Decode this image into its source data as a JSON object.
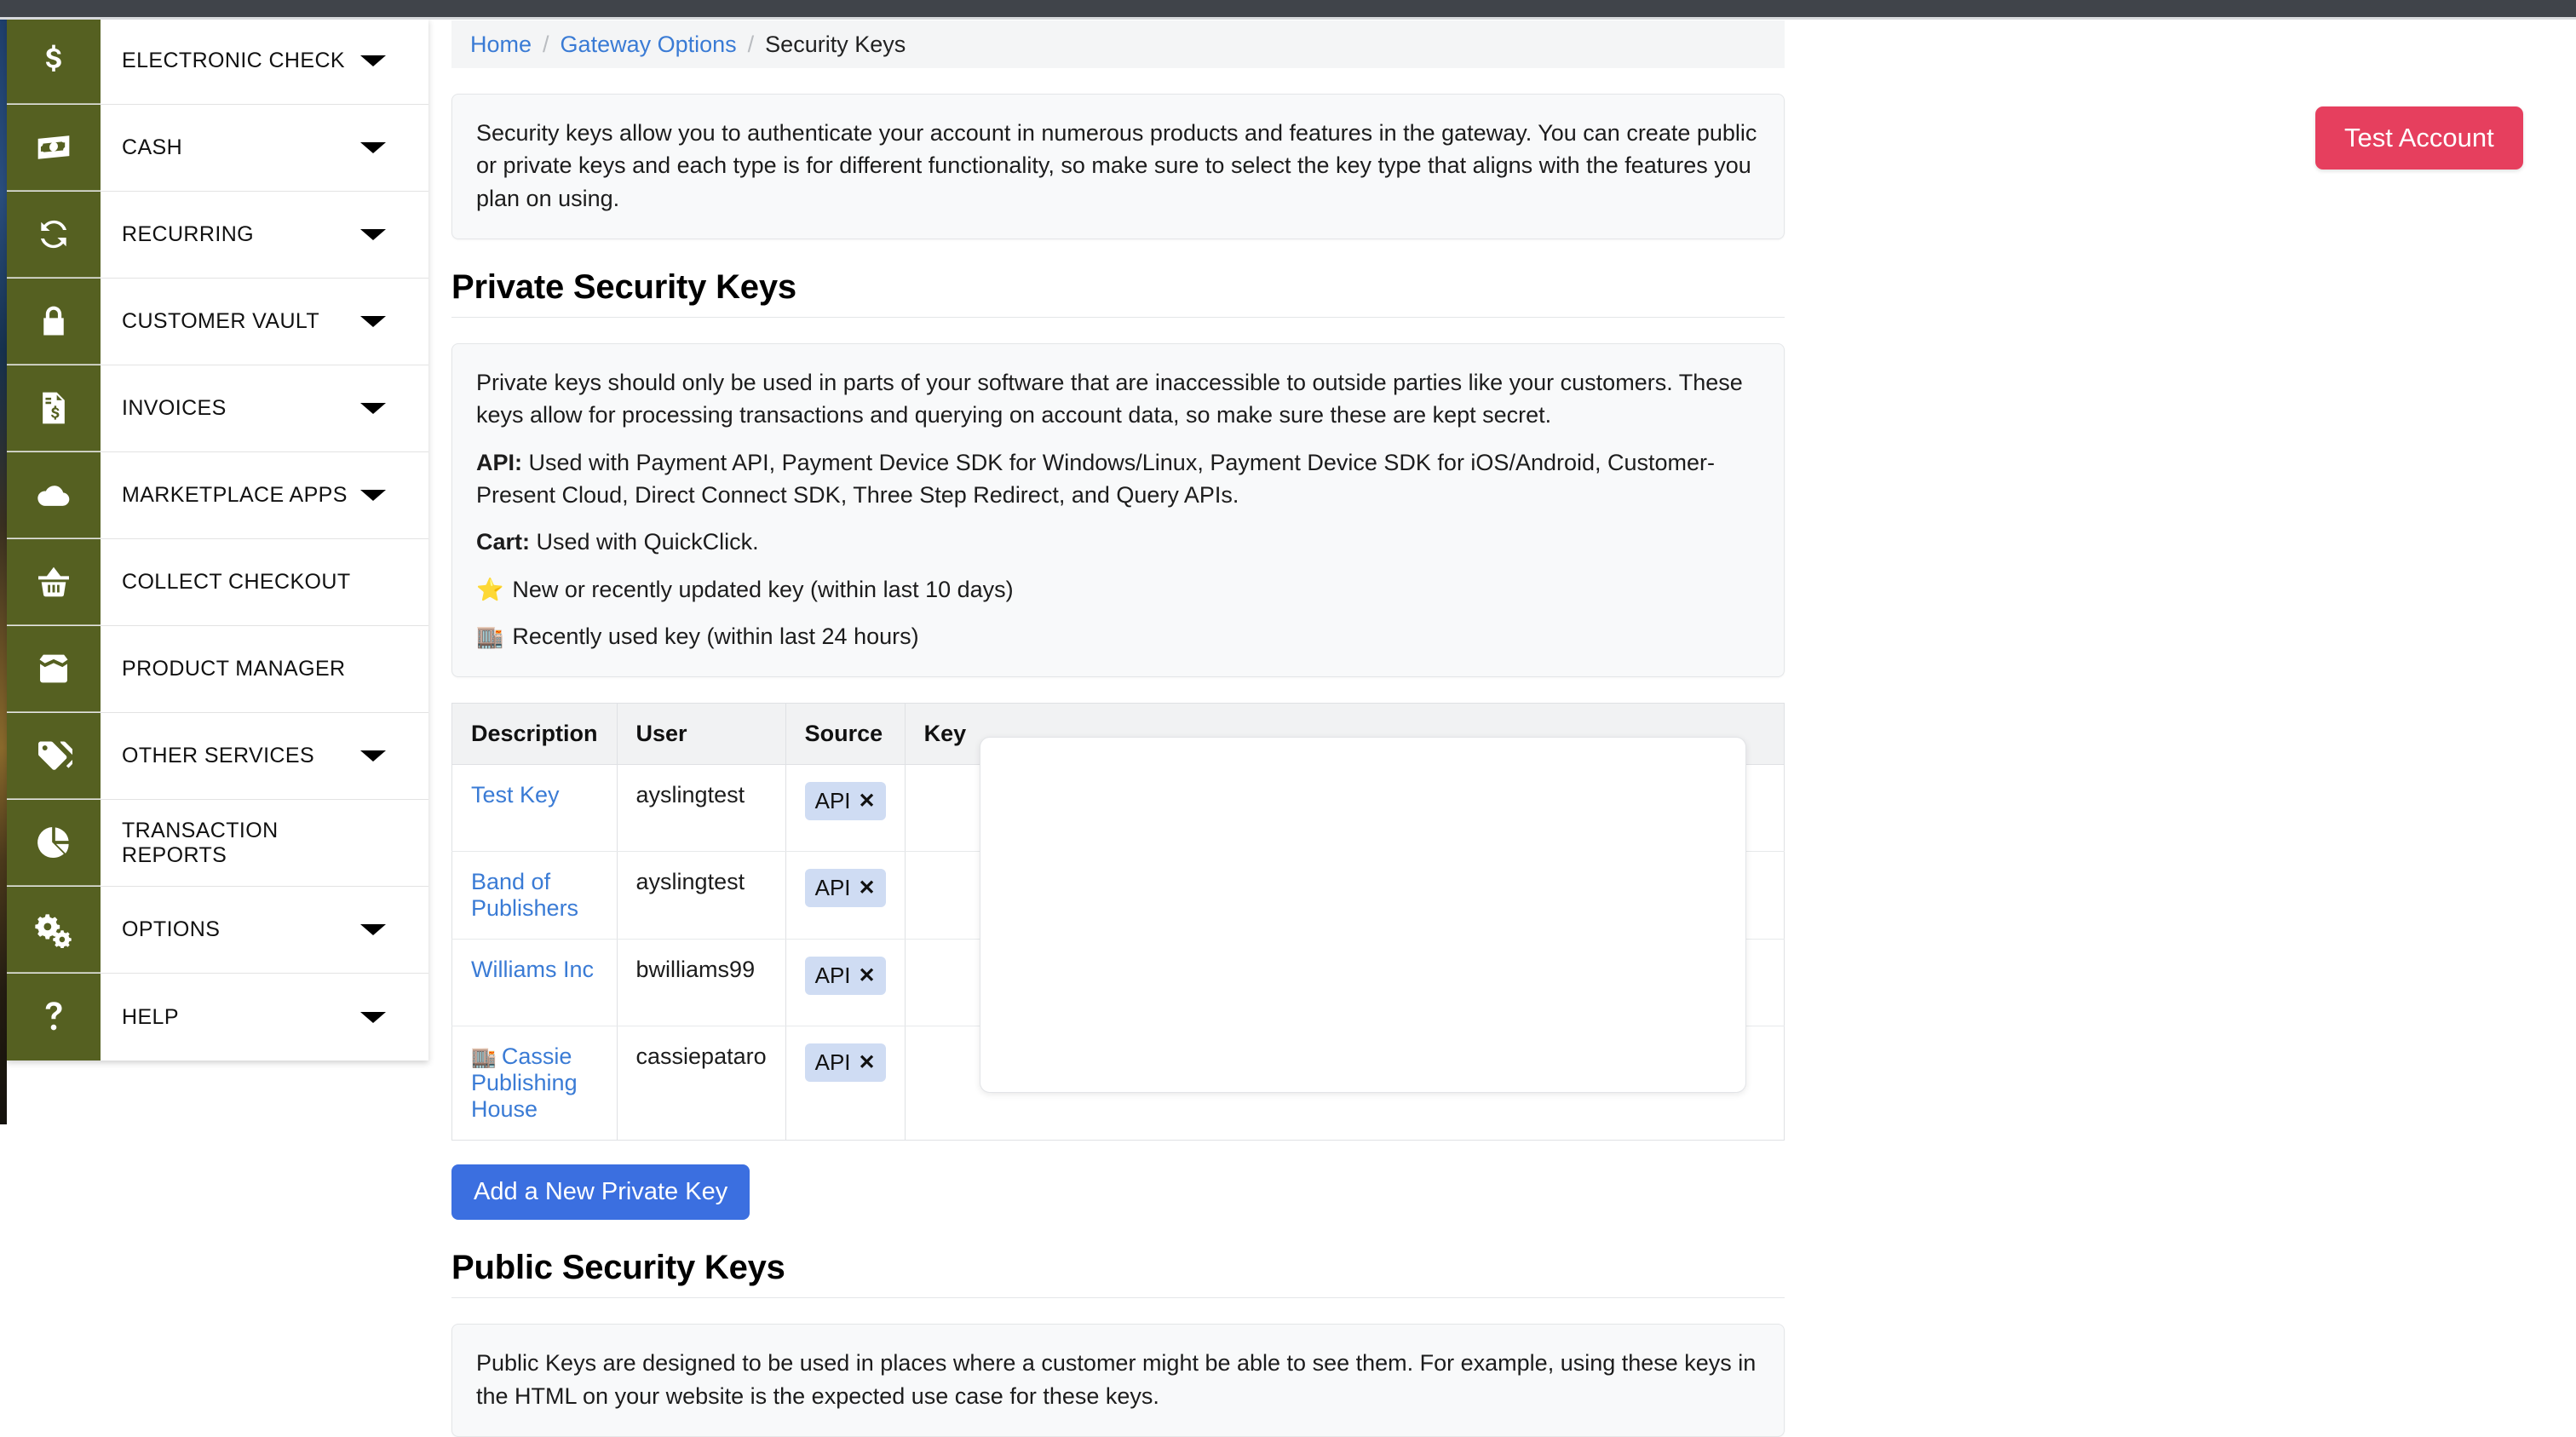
{
  "sidebar": {
    "items": [
      {
        "label": "ELECTRONIC CHECK",
        "icon": "dollar-icon",
        "has_caret": true
      },
      {
        "label": "CASH",
        "icon": "banknote-icon",
        "has_caret": true
      },
      {
        "label": "RECURRING",
        "icon": "recycle-arrows-icon",
        "has_caret": true
      },
      {
        "label": "CUSTOMER VAULT",
        "icon": "lock-icon",
        "has_caret": true
      },
      {
        "label": "INVOICES",
        "icon": "invoice-document-icon",
        "has_caret": true
      },
      {
        "label": "MARKETPLACE APPS",
        "icon": "cloud-icon",
        "has_caret": true
      },
      {
        "label": "COLLECT CHECKOUT",
        "icon": "basket-icon",
        "has_caret": false
      },
      {
        "label": "PRODUCT MANAGER",
        "icon": "open-box-icon",
        "has_caret": false
      },
      {
        "label": "OTHER SERVICES",
        "icon": "tags-icon",
        "has_caret": true
      },
      {
        "label": "TRANSACTION REPORTS",
        "icon": "pie-chart-icon",
        "has_caret": false
      },
      {
        "label": "OPTIONS",
        "icon": "gears-icon",
        "has_caret": true
      },
      {
        "label": "HELP",
        "icon": "question-mark-icon",
        "has_caret": true
      }
    ]
  },
  "header": {
    "test_account_label": "Test Account"
  },
  "breadcrumb": {
    "home": "Home",
    "gateway_options": "Gateway Options",
    "current": "Security Keys",
    "separator": "/"
  },
  "intro": {
    "text": "Security keys allow you to authenticate your account in numerous products and features in the gateway. You can create public or private keys and each type is for different functionality, so make sure to select the key type that aligns with the features you plan on using."
  },
  "private_section": {
    "title": "Private Security Keys",
    "description": "Private keys should only be used in parts of your software that are inaccessible to outside parties like your customers. These keys allow for processing transactions and querying on account data, so make sure these are kept secret.",
    "api_label": "API:",
    "api_text": " Used with Payment API, Payment Device SDK for Windows/Linux, Payment Device SDK for iOS/Android, Customer-Present Cloud, Direct Connect SDK, Three Step Redirect, and Query APIs.",
    "cart_label": "Cart:",
    "cart_text": " Used with QuickClick.",
    "legend_new_emoji": "⭐",
    "legend_new_text": "New or recently updated key (within last 10 days)",
    "legend_used_emoji": "🏬",
    "legend_used_text": "Recently used key (within last 24 hours)",
    "add_button_label": "Add a New Private Key",
    "table": {
      "columns": [
        "Description",
        "User",
        "Source",
        "Key"
      ],
      "rows": [
        {
          "emoji": "",
          "description": "Test Key",
          "user": "ayslingtest",
          "source": "API",
          "source_x": "✕",
          "key": ""
        },
        {
          "emoji": "",
          "description": "Band of Publishers",
          "user": "ayslingtest",
          "source": "API",
          "source_x": "✕",
          "key": ""
        },
        {
          "emoji": "",
          "description": "Williams Inc",
          "user": "bwilliams99",
          "source": "API",
          "source_x": "✕",
          "key": ""
        },
        {
          "emoji": "🏬",
          "description": "Cassie Publishing House",
          "user": "cassiepataro",
          "source": "API",
          "source_x": "✕",
          "key": ""
        }
      ]
    }
  },
  "public_section": {
    "title": "Public Security Keys",
    "description": "Public Keys are designed to be used in places where a customer might be able to see them. For example, using these keys in the HTML on your website is the expected use case for these keys."
  },
  "colors": {
    "sidebar_icon_bg": "#556021",
    "top_bar": "#40444a",
    "link": "#3a7bd5",
    "primary_button": "#3b6fe0",
    "test_account_button": "#e63f5e",
    "badge_bg": "#cfdcf3",
    "panel_bg": "#f8f9fa"
  }
}
